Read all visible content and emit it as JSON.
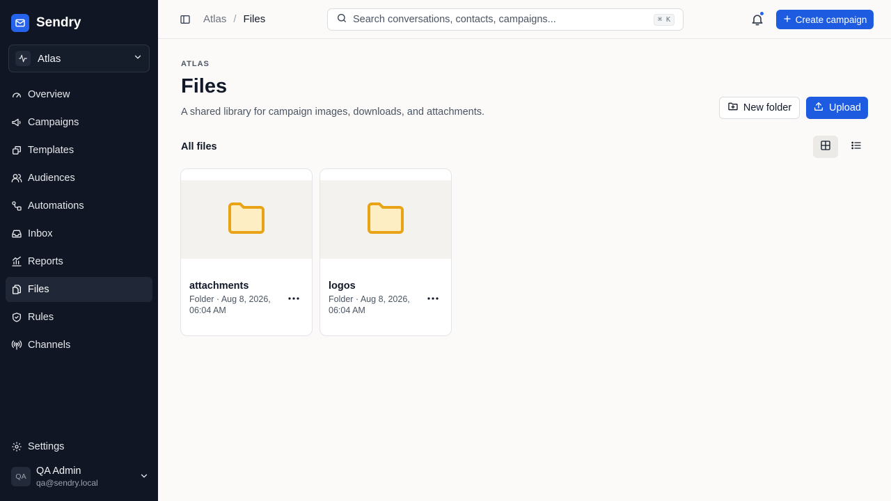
{
  "brand": {
    "name": "Sendry"
  },
  "workspace": {
    "name": "Atlas"
  },
  "nav": [
    {
      "label": "Overview",
      "icon": "gauge-icon"
    },
    {
      "label": "Campaigns",
      "icon": "megaphone-icon"
    },
    {
      "label": "Templates",
      "icon": "template-icon"
    },
    {
      "label": "Audiences",
      "icon": "users-icon"
    },
    {
      "label": "Automations",
      "icon": "workflow-icon"
    },
    {
      "label": "Inbox",
      "icon": "inbox-icon"
    },
    {
      "label": "Reports",
      "icon": "chart-icon"
    },
    {
      "label": "Files",
      "icon": "files-icon",
      "active": true
    },
    {
      "label": "Rules",
      "icon": "shield-icon"
    },
    {
      "label": "Channels",
      "icon": "radio-icon"
    }
  ],
  "settings": {
    "label": "Settings"
  },
  "user": {
    "initials": "QA",
    "name": "QA Admin",
    "email": "qa@sendry.local"
  },
  "topbar": {
    "breadcrumb": {
      "parent": "Atlas",
      "separator": "/",
      "current": "Files"
    },
    "search": {
      "placeholder": "Search conversations, contacts, campaigns...",
      "shortcut": "⌘ K"
    },
    "create_label": "Create campaign"
  },
  "page": {
    "eyebrow": "ATLAS",
    "title": "Files",
    "subtitle": "A shared library for campaign images, downloads, and attachments.",
    "new_folder_label": "New folder",
    "upload_label": "Upload",
    "section_title": "All files"
  },
  "files": [
    {
      "name": "attachments",
      "meta": "Folder · Aug 8, 2026, 06:04 AM"
    },
    {
      "name": "logos",
      "meta": "Folder · Aug 8, 2026, 06:04 AM"
    }
  ],
  "colors": {
    "accent": "#1d5be0",
    "sidebar": "#101623",
    "folder": "#e8a317"
  }
}
